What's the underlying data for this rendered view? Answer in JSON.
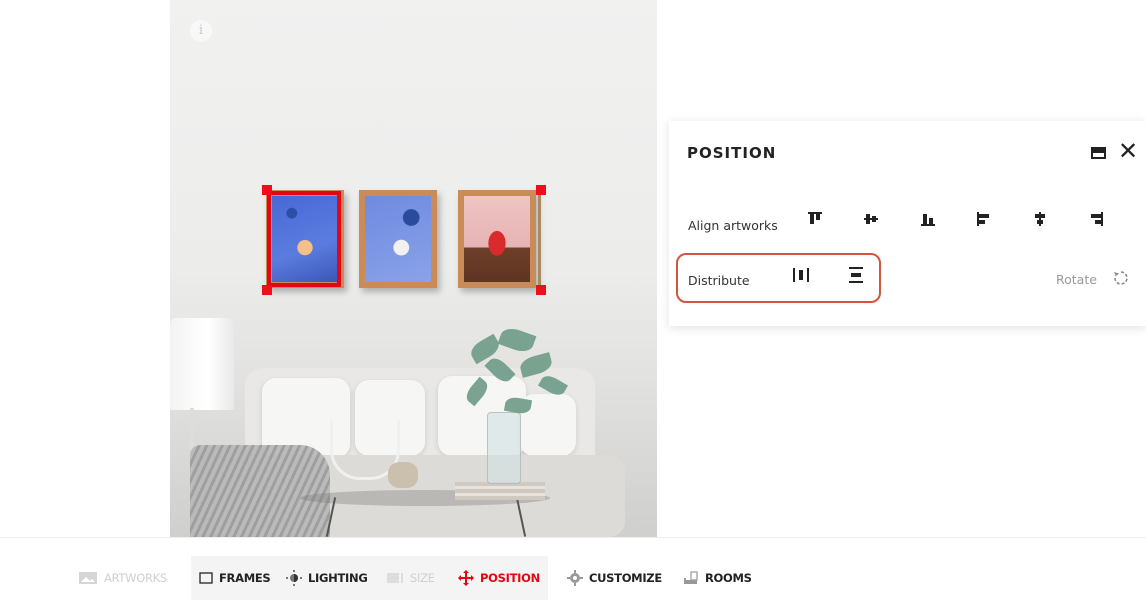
{
  "info_glyph": "i",
  "panel": {
    "title": "POSITION",
    "align_label": "Align artworks",
    "distribute_label": "Distribute",
    "rotate_label": "Rotate",
    "close_glyph": "✕",
    "align_icons": [
      "align-top-icon",
      "align-middle-vertical-icon",
      "align-bottom-icon",
      "align-left-icon",
      "align-center-horizontal-icon",
      "align-right-icon"
    ],
    "distribute_icons": [
      "distribute-horizontal-icon",
      "distribute-vertical-icon"
    ]
  },
  "toolbar": {
    "tabs": [
      {
        "label": "ARTWORKS",
        "state": "disabled"
      },
      {
        "label": "FRAMES",
        "state": "normal"
      },
      {
        "label": "LIGHTING",
        "state": "normal"
      },
      {
        "label": "SIZE",
        "state": "disabled"
      },
      {
        "label": "POSITION",
        "state": "active"
      },
      {
        "label": "CUSTOMIZE",
        "state": "normal"
      },
      {
        "label": "ROOMS",
        "state": "normal"
      }
    ]
  },
  "colors": {
    "accent": "#e30613",
    "highlight": "#d2553e"
  }
}
